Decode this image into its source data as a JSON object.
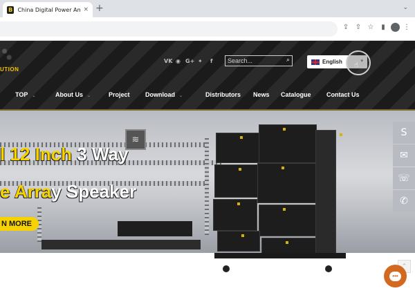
{
  "browser": {
    "tab_title": "China Digital Power Amplifier, Pro",
    "tab_close": "×",
    "new_tab": "+",
    "favicon": "B",
    "tab_menu": "⌄",
    "icons": [
      "share-icon",
      "upload-icon",
      "star-icon",
      "sidebar-icon",
      "profile-icon",
      "menu-icon"
    ]
  },
  "header": {
    "logo_fragment": "UTION",
    "social_icons": [
      "vk-icon",
      "weibo-icon",
      "google-plus-icon",
      "twitter-icon",
      "facebook-icon"
    ],
    "social_glyphs": {
      "vk": "VK",
      "weibo": "◉",
      "gplus": "G+",
      "twitter": "✦",
      "facebook": "f"
    },
    "search": {
      "placeholder": "Search...",
      "icon": "⌕"
    },
    "language": {
      "label": "English",
      "caret": "▾"
    }
  },
  "nav": {
    "items": [
      {
        "label": "TOP",
        "has_caret": true
      },
      {
        "label": "About Us",
        "has_caret": true
      },
      {
        "label": "Project",
        "has_caret": false
      },
      {
        "label": "Download",
        "has_caret": true
      },
      {
        "label": "Distributors",
        "has_caret": false
      },
      {
        "label": "News",
        "has_caret": false
      },
      {
        "label": "Catalogue",
        "has_caret": false
      },
      {
        "label": "Contact Us",
        "has_caret": false
      }
    ],
    "caret": "⌄"
  },
  "hero": {
    "title_part1": "l 12 Inch",
    "title_part2": " 3 Way",
    "subtitle_part1": "e Arra",
    "subtitle_part2": "y Speaker",
    "button": "N MORE"
  },
  "side_bar": {
    "glyphs": {
      "skype": "S",
      "email": "✉",
      "phone": "☏",
      "whatsapp": "✆"
    }
  },
  "widgets": {
    "up": "⌃",
    "chat": "•••"
  },
  "colors": {
    "accent_yellow": "#f6d300",
    "header_dark": "#1b1b1b",
    "chat_orange": "#d2691e",
    "side_grey": "#b8bcc2"
  }
}
